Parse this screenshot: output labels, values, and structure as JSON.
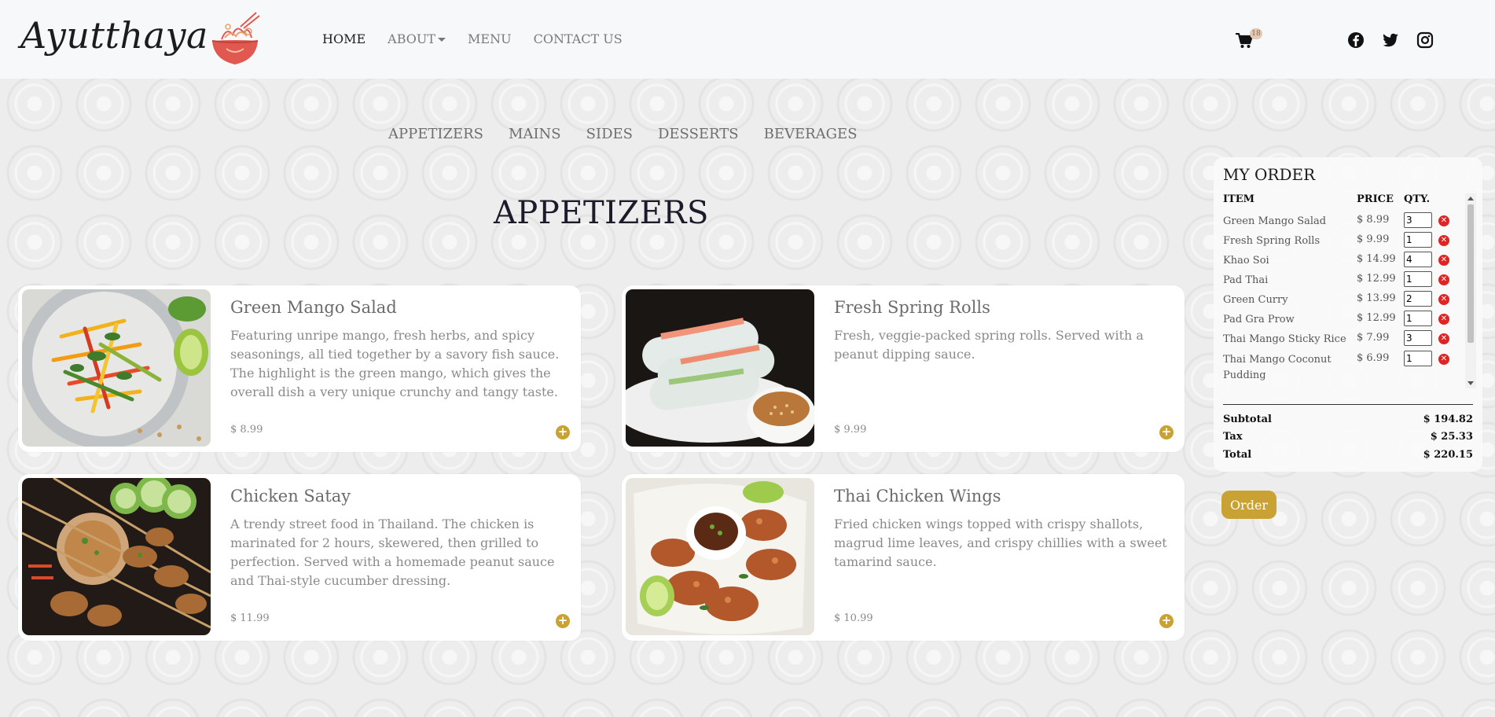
{
  "brand": {
    "name": "Ayutthaya",
    "accent": "#c9a233"
  },
  "nav": {
    "home": "HOME",
    "about": "ABOUT",
    "menu": "MENU",
    "contact": "CONTACT US"
  },
  "cart": {
    "icon": "cart-icon",
    "count": "18"
  },
  "social": [
    "facebook-icon",
    "twitter-icon",
    "instagram-icon"
  ],
  "categories": [
    "APPETIZERS",
    "MAINS",
    "SIDES",
    "DESSERTS",
    "BEVERAGES"
  ],
  "section_title": "APPETIZERS",
  "dishes": [
    {
      "name": "Green Mango Salad",
      "desc": "Featuring unripe mango, fresh herbs, and spicy seasonings, all tied together by a savory fish sauce. The highlight is the green mango, which gives the overall dish a very unique crunchy and tangy taste.",
      "price": "$ 8.99"
    },
    {
      "name": "Fresh Spring Rolls",
      "desc": "Fresh, veggie-packed spring rolls. Served with a peanut dipping sauce.",
      "price": "$ 9.99"
    },
    {
      "name": "Chicken Satay",
      "desc": "A trendy street food in Thailand. The chicken is marinated for 2 hours, skewered, then grilled to perfection. Served with a homemade peanut sauce and Thai-style cucumber dressing.",
      "price": "$ 11.99"
    },
    {
      "name": "Thai Chicken Wings",
      "desc": "Fried chicken wings topped with crispy shallots, magrud lime leaves, and crispy chillies with a sweet tamarind sauce.",
      "price": "$ 10.99"
    }
  ],
  "order": {
    "title": "MY ORDER",
    "headers": {
      "item": "ITEM",
      "price": "PRICE",
      "qty": "QTY."
    },
    "items": [
      {
        "name": "Green Mango Salad",
        "price": "$ 8.99",
        "qty": "3"
      },
      {
        "name": "Fresh Spring Rolls",
        "price": "$ 9.99",
        "qty": "1"
      },
      {
        "name": "Khao Soi",
        "price": "$ 14.99",
        "qty": "4"
      },
      {
        "name": "Pad Thai",
        "price": "$ 12.99",
        "qty": "1"
      },
      {
        "name": "Green Curry",
        "price": "$ 13.99",
        "qty": "2"
      },
      {
        "name": "Pad Gra Prow",
        "price": "$ 12.99",
        "qty": "1"
      },
      {
        "name": "Thai Mango Sticky Rice",
        "price": "$ 7.99",
        "qty": "3"
      },
      {
        "name": "Thai Mango Coconut Pudding",
        "price": "$ 6.99",
        "qty": "1"
      }
    ],
    "subtotal_label": "Subtotal",
    "subtotal": "$ 194.82",
    "tax_label": "Tax",
    "tax": "$ 25.33",
    "total_label": "Total",
    "total": "$ 220.15",
    "button": "Order"
  }
}
